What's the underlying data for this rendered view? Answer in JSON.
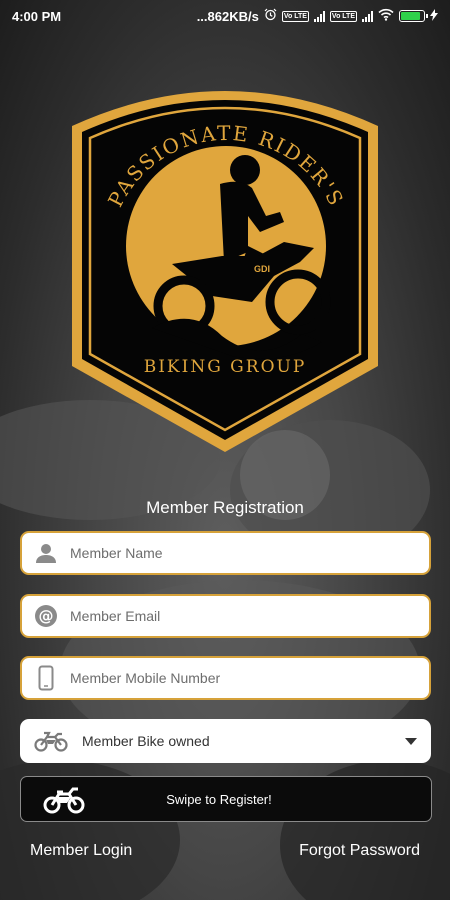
{
  "status_bar": {
    "time": "4:00 PM",
    "net_speed": "...862KB/s",
    "volte1": "Vo LTE",
    "volte2": "Vo LTE",
    "battery_label": "",
    "battery_level": 0.85,
    "battery_color": "#2fd14b"
  },
  "logo": {
    "title": "PASSIONATE RIDER'S",
    "subtitle": "BIKING GROUP",
    "plate": "GDI"
  },
  "form": {
    "heading": "Member Registration",
    "name_placeholder": "Member Name",
    "email_placeholder": "Member Email",
    "mobile_placeholder": "Member Mobile Number",
    "bike_select_value": "Member Bike owned",
    "swipe_label": "Swipe to Register!"
  },
  "links": {
    "login": "Member Login",
    "forgot": "Forgot Password"
  },
  "colors": {
    "accent": "#d6a23a",
    "logo_gold": "#e0a63d",
    "field_bg": "#ffffff",
    "swipe_bg": "#0b0b0b"
  },
  "icons": {
    "name": "person-icon",
    "email": "at-sign-icon",
    "mobile": "phone-icon",
    "bike": "motorbike-icon",
    "caret": "dropdown-caret-icon"
  }
}
